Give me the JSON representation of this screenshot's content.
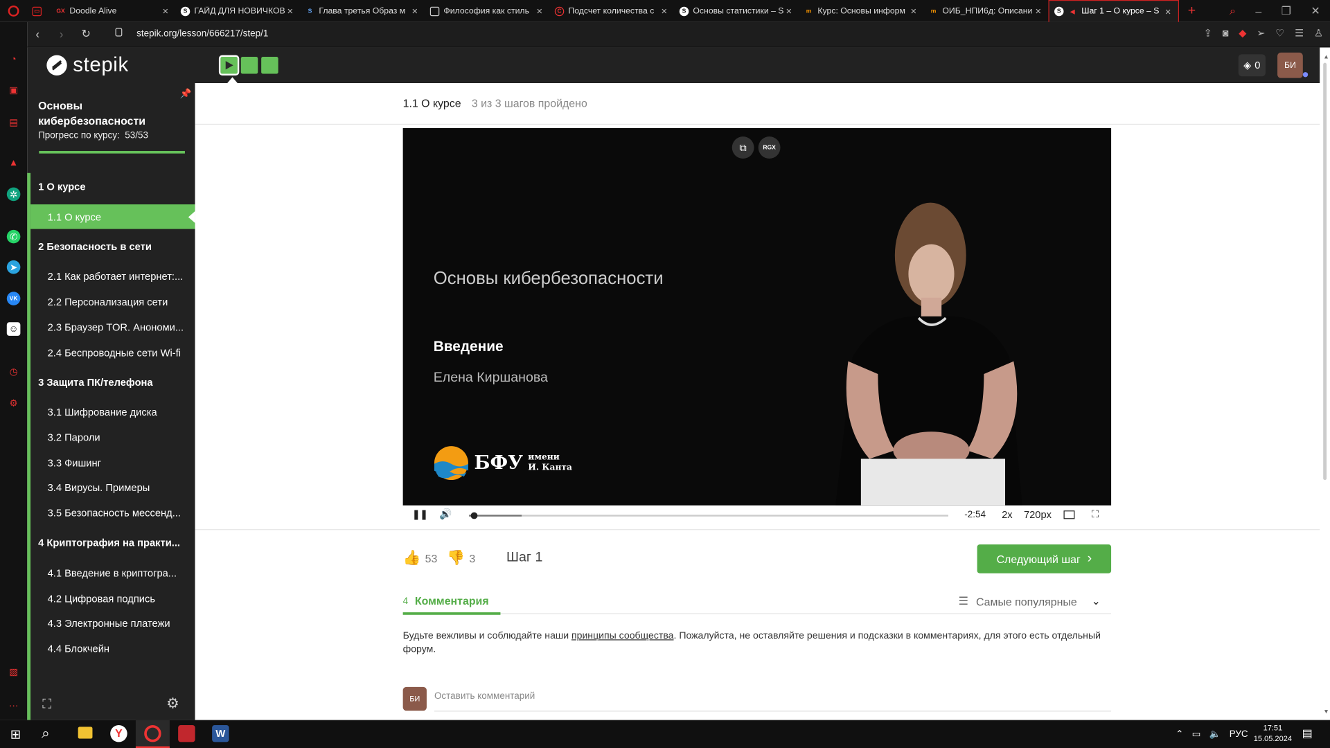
{
  "browser": {
    "tabs": [
      {
        "icon": "gx",
        "title": "Doodle Alive"
      },
      {
        "icon": "stepik",
        "title": "ГАЙД ДЛЯ НОВИЧКОВ"
      },
      {
        "icon": "s",
        "title": "Глава третья Образ м"
      },
      {
        "icon": "doc",
        "title": "Философия как стиль"
      },
      {
        "icon": "c",
        "title": "Подсчет количества с"
      },
      {
        "icon": "stepik",
        "title": "Основы статистики – S"
      },
      {
        "icon": "m",
        "title": "Курс: Основы информ"
      },
      {
        "icon": "m",
        "title": "ОИБ_НПИ6д: Описани"
      },
      {
        "icon": "stepik",
        "title": "Шаг 1 – О курсе – S"
      }
    ],
    "url": "stepik.org/lesson/666217/step/1"
  },
  "header": {
    "logo": "stepik",
    "streak_count": "0",
    "avatar": "БИ"
  },
  "course": {
    "title": "Основы кибербезопасности",
    "progress_label": "Прогресс по курсу:",
    "progress_value": "53/53",
    "progress_fraction": 1.0,
    "modules": [
      {
        "label": "1  О курсе",
        "lessons": [
          {
            "label": "1.1  О курсе",
            "active": true
          }
        ]
      },
      {
        "label": "2  Безопасность в сети",
        "lessons": [
          {
            "label": "2.1  Как работает интернет:..."
          },
          {
            "label": "2.2  Персонализация сети"
          },
          {
            "label": "2.3  Браузер TOR. Анономи..."
          },
          {
            "label": "2.4  Беспроводные сети Wi-fi"
          }
        ]
      },
      {
        "label": "3  Защита ПК/телефона",
        "lessons": [
          {
            "label": "3.1  Шифрование диска"
          },
          {
            "label": "3.2  Пароли"
          },
          {
            "label": "3.3  Фишинг"
          },
          {
            "label": "3.4  Вирусы. Примеры"
          },
          {
            "label": "3.5  Безопасность мессенд..."
          }
        ]
      },
      {
        "label": "4  Криптография на практи...",
        "lessons": [
          {
            "label": "4.1  Введение в криптогра..."
          },
          {
            "label": "4.2  Цифровая подпись"
          },
          {
            "label": "4.3  Электронные платежи"
          },
          {
            "label": "4.4  Блокчейн"
          }
        ]
      }
    ]
  },
  "lesson": {
    "title": "1.1 О курсе",
    "progress_text": "3 из 3 шагов пройдено",
    "step_label": "Шаг 1",
    "likes": "53",
    "dislikes": "3",
    "next_button": "Следующий шаг"
  },
  "video": {
    "overlay_badge": "RGX",
    "title": "Основы кибербезопасности",
    "subtitle": "Введение",
    "author": "Елена Киршанова",
    "logo_text": "БФУ",
    "logo_small_1": "имени",
    "logo_small_2": "И. Канта",
    "time_remaining": "-2:54",
    "speed": "2x",
    "quality": "720px",
    "progress_fraction": 0.01,
    "buffered_fraction": 0.11
  },
  "comments": {
    "count": "4",
    "tab_label": "Комментария",
    "sort_label": "Самые популярные",
    "notice_before": "Будьте вежливы и соблюдайте наши ",
    "notice_link": "принципы сообщества",
    "notice_after": ". Пожалуйста, не оставляйте решения и подсказки в комментариях, для этого есть отдельный форум.",
    "placeholder": "Оставить комментарий",
    "avatar": "БИ"
  },
  "taskbar": {
    "lang": "РУС",
    "time": "17:51",
    "date": "15.05.2024"
  }
}
